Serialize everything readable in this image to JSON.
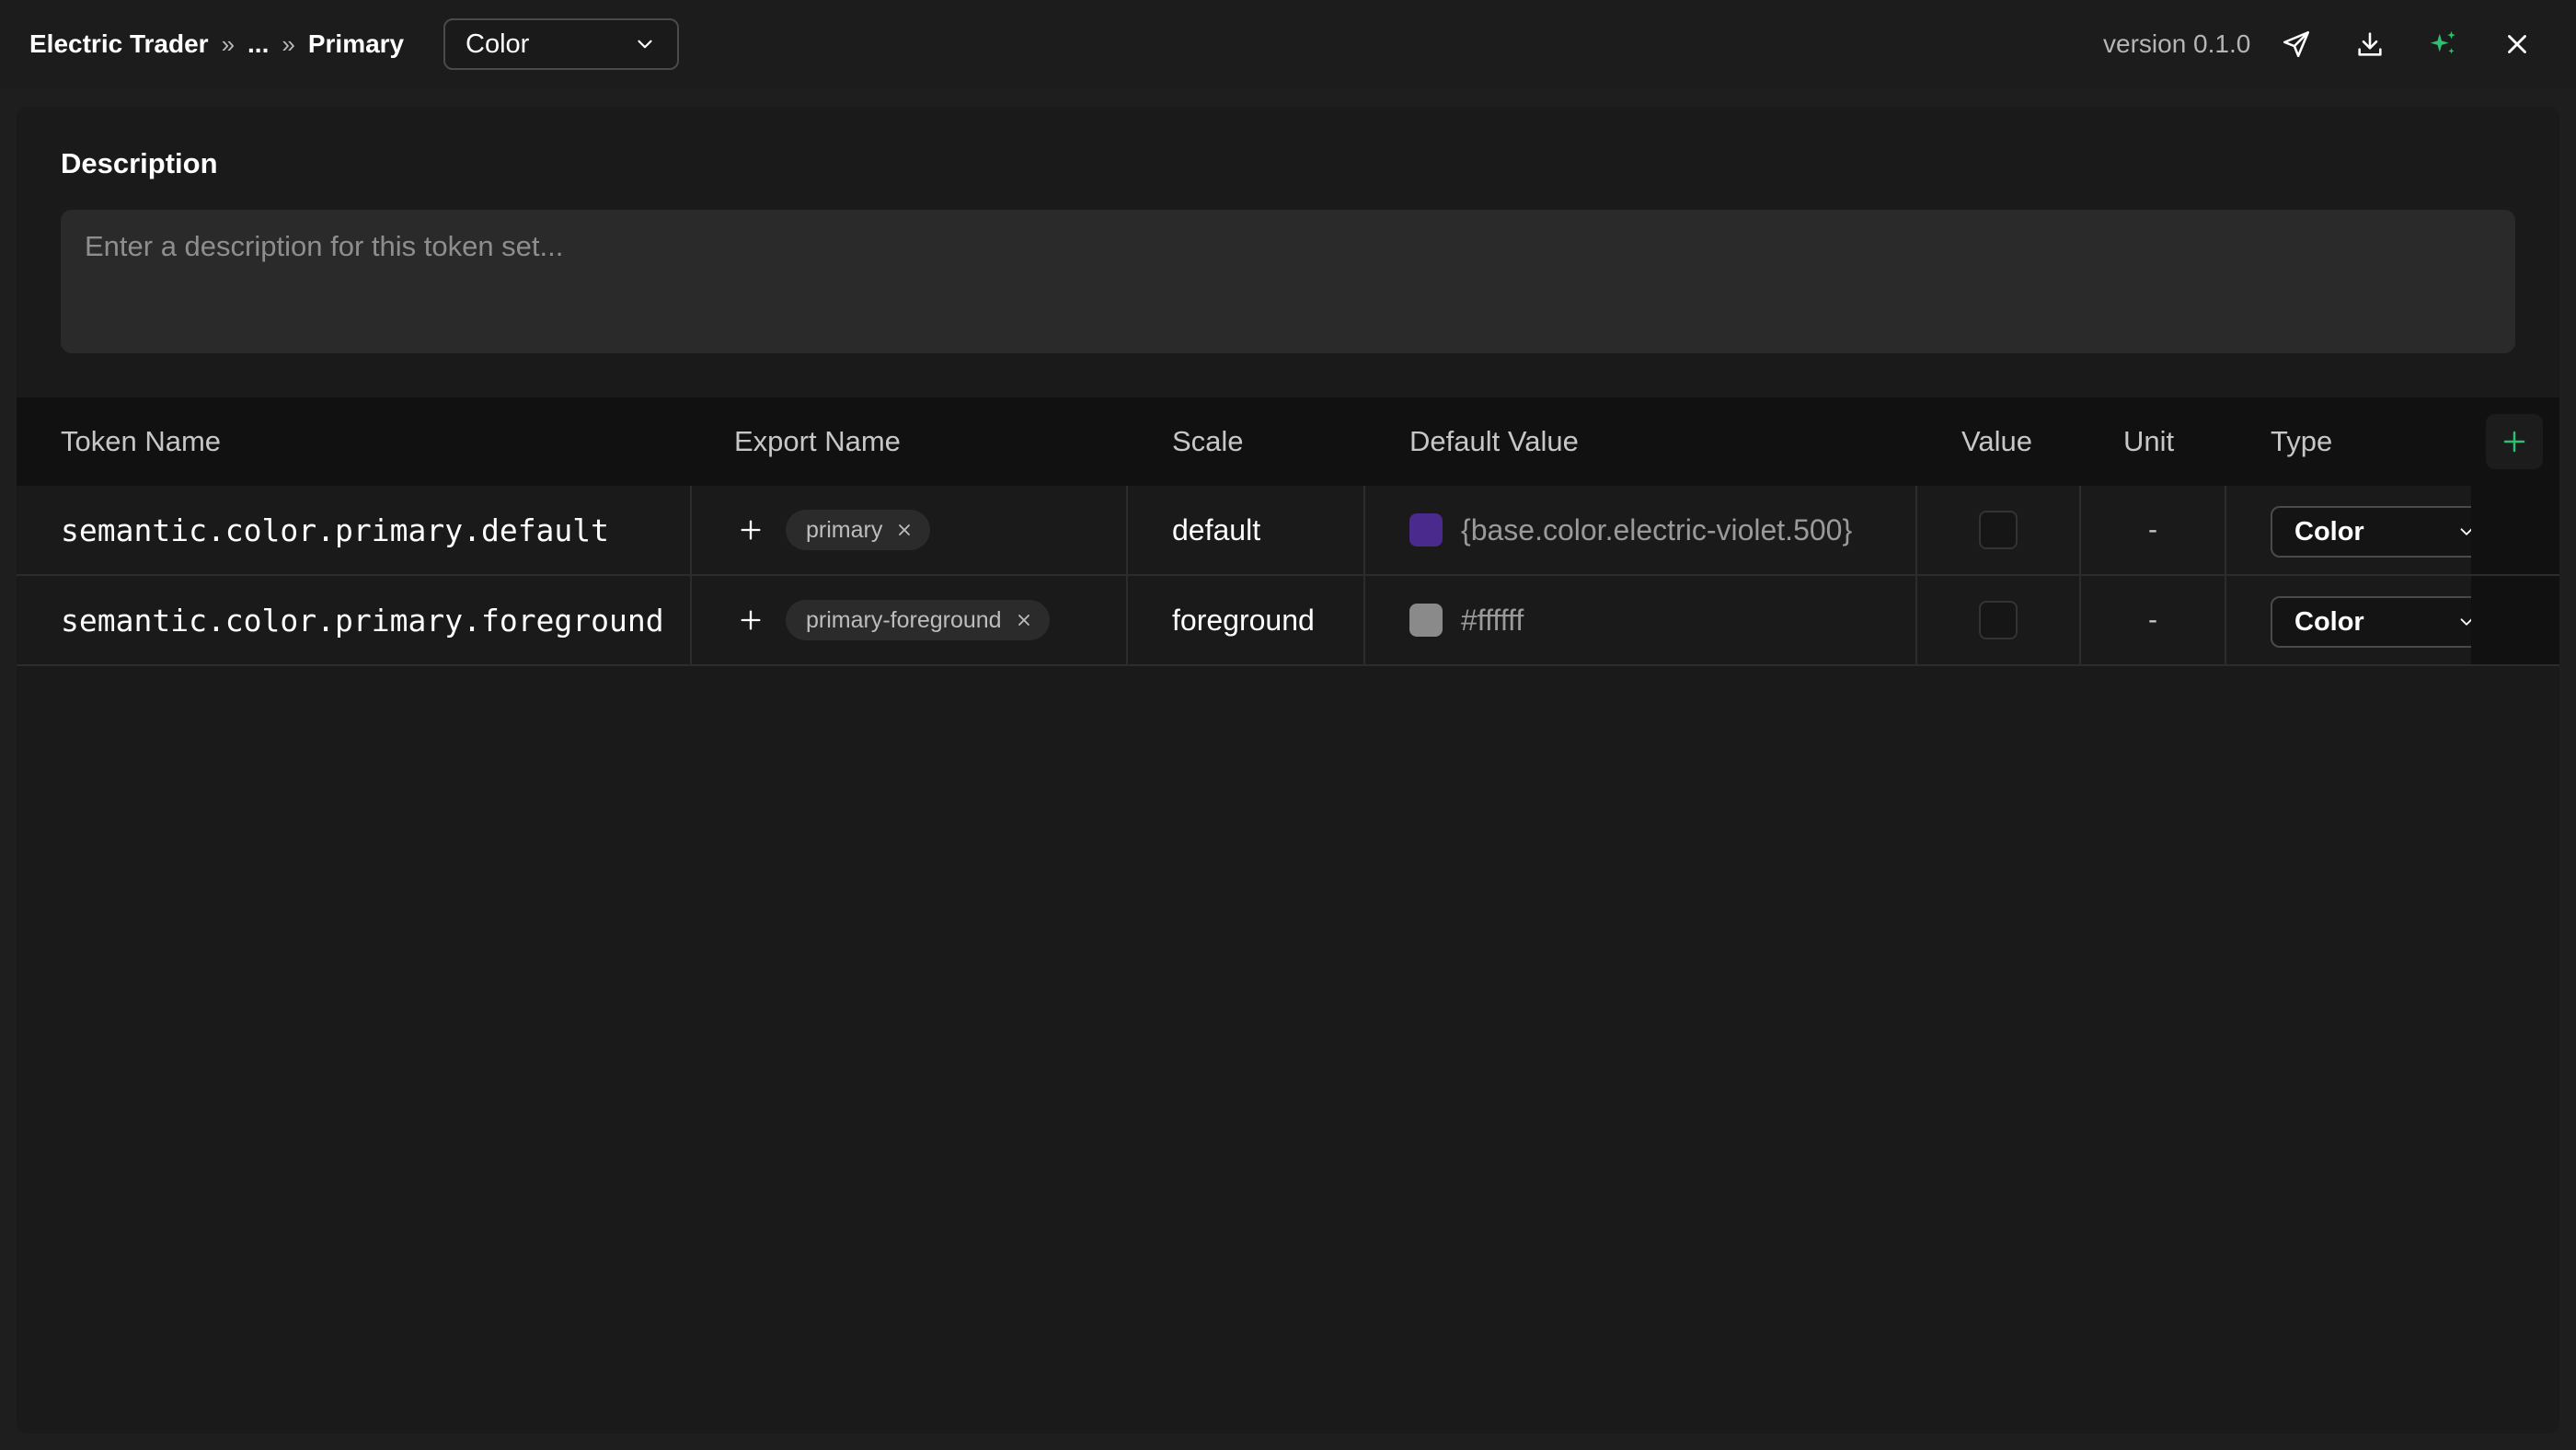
{
  "breadcrumb": {
    "root": "Electric Trader",
    "middle": "...",
    "current": "Primary",
    "separator": "»"
  },
  "category_select": {
    "value": "Color"
  },
  "header": {
    "version": "version 0.1.0"
  },
  "description": {
    "label": "Description",
    "placeholder": "Enter a description for this token set..."
  },
  "table": {
    "columns": {
      "token_name": "Token Name",
      "export_name": "Export Name",
      "scale": "Scale",
      "default_value": "Default Value",
      "value": "Value",
      "unit": "Unit",
      "type": "Type"
    },
    "rows": [
      {
        "token_name": "semantic.color.primary.default",
        "export_name": "primary",
        "scale": "default",
        "default_value": "{base.color.electric-violet.500}",
        "swatch_color": "#4a2a8c",
        "unit": "-",
        "type": "Color"
      },
      {
        "token_name": "semantic.color.primary.foreground",
        "export_name": "primary-foreground",
        "scale": "foreground",
        "default_value": "#ffffff",
        "swatch_color": "#8a8a8a",
        "unit": "-",
        "type": "Color"
      }
    ]
  },
  "icons": {
    "send": "send-icon",
    "download": "download-icon",
    "ai": "sparkle-icon",
    "close": "close-icon",
    "add_column": "plus-icon"
  },
  "colors": {
    "accent_green": "#2fbf71"
  }
}
